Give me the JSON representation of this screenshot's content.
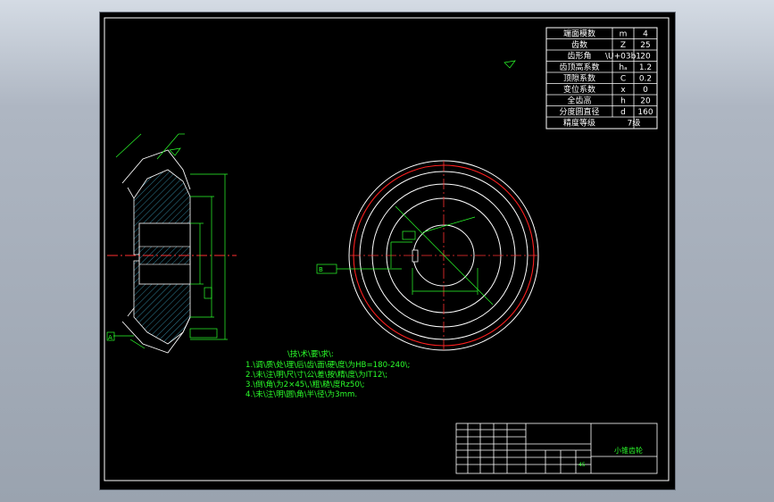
{
  "params": [
    {
      "name": "端面模数",
      "sym": "m",
      "val": "4"
    },
    {
      "name": "齿数",
      "sym": "Z",
      "val": "25"
    },
    {
      "name": "齿形角",
      "sym": "\\U+03b1",
      "val": "20"
    },
    {
      "name": "齿顶高系数",
      "sym": "hₐ",
      "val": "1.2"
    },
    {
      "name": "顶隙系数",
      "sym": "C",
      "val": "0.2"
    },
    {
      "name": "变位系数",
      "sym": "x",
      "val": "0"
    },
    {
      "name": "全齿高",
      "sym": "h",
      "val": "20"
    },
    {
      "name": "分度圆直径",
      "sym": "d",
      "val": "160"
    },
    {
      "name": "精度等级",
      "sym": "",
      "val": "7级"
    }
  ],
  "notes_title": "\\技\\术\\要\\求\\:",
  "notes": [
    "1.\\调\\质\\处\\理\\后\\齿\\面\\硬\\度\\为HB=180-240\\;",
    "2.\\未\\注\\明\\尺\\寸\\公\\差\\按\\精\\度\\为IT12\\;",
    "3.\\倒\\角\\为2×45\\,\\粗\\糙\\度Rz50\\;",
    "4.\\未\\注\\明\\圆\\角\\半\\径\\为3mm."
  ],
  "title_block": {
    "part_name": "小锥齿轮",
    "material": "45"
  },
  "datum_labels": {
    "a": "A",
    "b": "B"
  },
  "colors": {
    "line": "#2bff2b",
    "text": "#ffffff",
    "pitch": "#ff2020",
    "hatch": "#4fd7ff",
    "axis": "#ff3030"
  }
}
